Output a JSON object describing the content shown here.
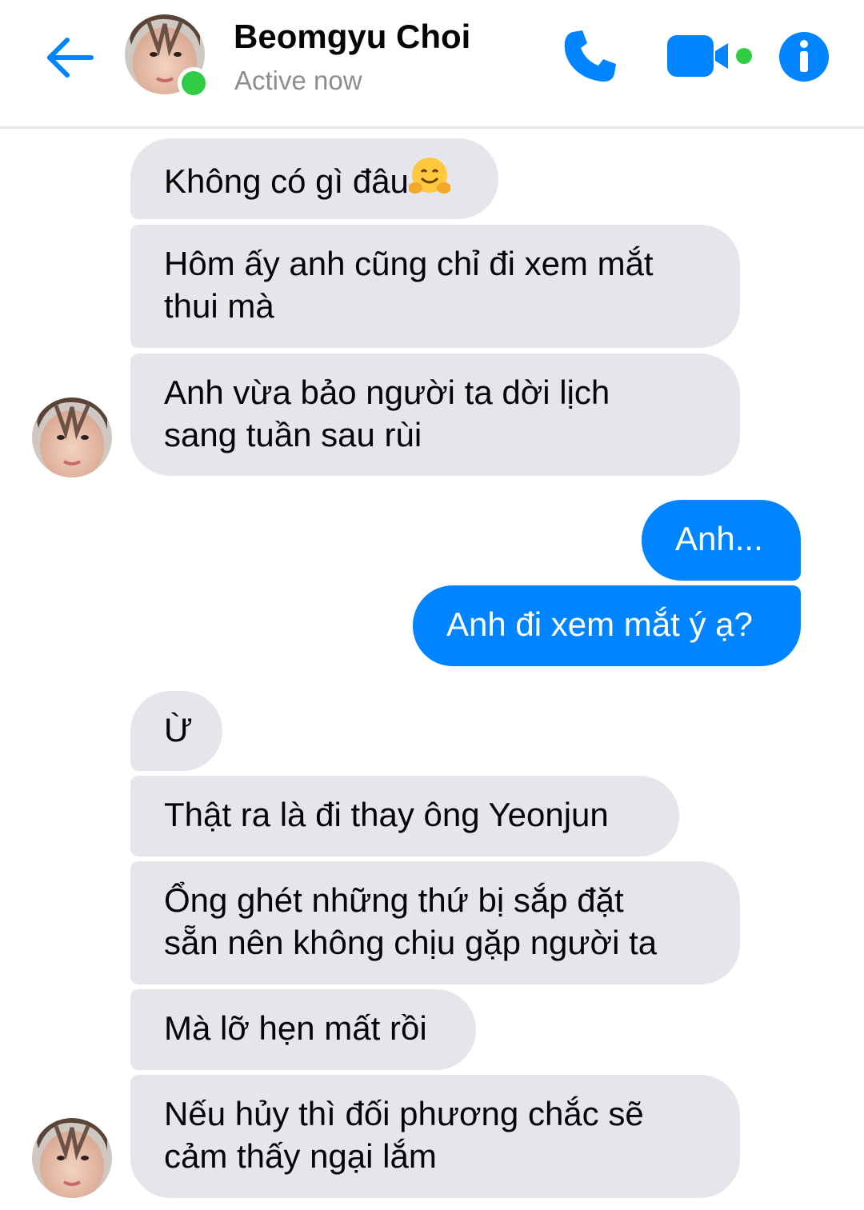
{
  "header": {
    "back_label": "Back",
    "contact_name": "Beomgyu Choi",
    "status": "Active now",
    "accent_color": "#0084ff",
    "presence_color": "#31cc46"
  },
  "messages": [
    {
      "direction": "incoming",
      "lines": [
        "Không có gì đâu"
      ],
      "emoji": "hugging-face-emoji"
    },
    {
      "direction": "incoming",
      "lines": [
        "Hôm ấy anh cũng chỉ đi xem mắt",
        "thui mà"
      ]
    },
    {
      "direction": "incoming",
      "lines": [
        "Anh vừa bảo người ta dời lịch",
        "sang tuần sau rùi"
      ]
    },
    {
      "direction": "outgoing",
      "lines": [
        "Anh..."
      ]
    },
    {
      "direction": "outgoing",
      "lines": [
        "Anh đi xem mắt ý ạ?"
      ]
    },
    {
      "direction": "incoming",
      "lines": [
        "Ừ"
      ]
    },
    {
      "direction": "incoming",
      "lines": [
        "Thật ra là đi thay ông Yeonjun"
      ]
    },
    {
      "direction": "incoming",
      "lines": [
        "Ổng ghét những thứ bị sắp đặt",
        "sẵn nên không chịu gặp người ta"
      ]
    },
    {
      "direction": "incoming",
      "lines": [
        "Mà lỡ hẹn mất rồi"
      ]
    },
    {
      "direction": "incoming",
      "lines": [
        "Nếu hủy thì đối phương chắc sẽ",
        "cảm thấy ngại lắm"
      ]
    }
  ],
  "colors": {
    "incoming_bubble": "#e4e6eb",
    "outgoing_bubble": "#0084ff",
    "status_text": "#8a8d91"
  },
  "icons": [
    "back-arrow-icon",
    "phone-icon",
    "video-camera-icon",
    "info-icon",
    "hugging-face-emoji"
  ]
}
